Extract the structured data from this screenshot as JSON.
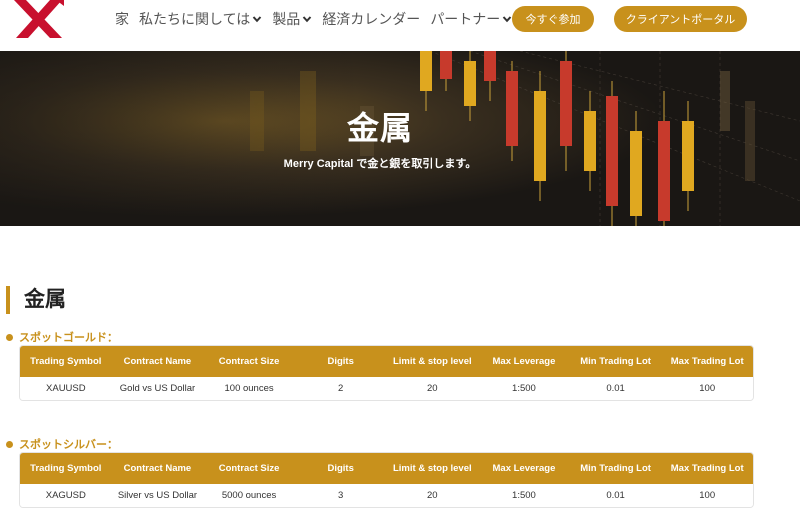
{
  "header": {
    "nav": [
      {
        "label": "家",
        "has_dropdown": false
      },
      {
        "label": "私たちに関しては",
        "has_dropdown": true
      },
      {
        "label": "製品",
        "has_dropdown": true
      },
      {
        "label": "経済カレンダー",
        "has_dropdown": false
      },
      {
        "label": "パートナー",
        "has_dropdown": true
      }
    ],
    "join_button": "今すぐ参加",
    "portal_button": "クライアントポータル"
  },
  "hero": {
    "title": "金属",
    "subtitle": "Merry Capital で金と銀を取引します。"
  },
  "section": {
    "title": "金属",
    "columns": [
      "Trading Symbol",
      "Contract Name",
      "Contract Size",
      "Digits",
      "Limit & stop level",
      "Max Leverage",
      "Min Trading Lot",
      "Max Trading Lot"
    ],
    "gold": {
      "heading": "スポットゴールド：",
      "row": [
        "XAUUSD",
        "Gold vs US Dollar",
        "100 ounces",
        "2",
        "20",
        "1:500",
        "0.01",
        "100"
      ]
    },
    "silver": {
      "heading": "スポットシルバー：",
      "row": [
        "XAGUSD",
        "Silver vs US Dollar",
        "5000 ounces",
        "3",
        "20",
        "1:500",
        "0.01",
        "100"
      ]
    }
  },
  "colors": {
    "accent": "#c8911c",
    "logo_red": "#c8102e",
    "hero_bg": "#1a1714"
  }
}
